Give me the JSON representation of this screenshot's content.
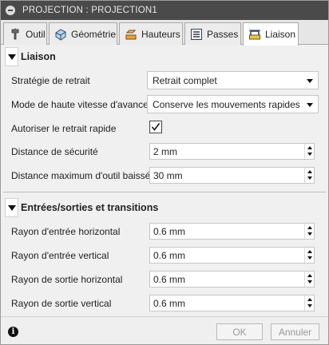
{
  "window": {
    "title": "PROJECTION : PROJECTION1"
  },
  "tabs": [
    {
      "label": "Outil",
      "icon": "tool-icon",
      "active": false
    },
    {
      "label": "Géométrie",
      "icon": "geometry-icon",
      "active": false
    },
    {
      "label": "Hauteurs",
      "icon": "heights-icon",
      "active": false
    },
    {
      "label": "Passes",
      "icon": "passes-icon",
      "active": false
    },
    {
      "label": "Liaison",
      "icon": "linking-icon",
      "active": true
    }
  ],
  "sections": {
    "liaison": {
      "title": "Liaison",
      "strategie": {
        "label": "Stratégie de retrait",
        "value": "Retrait complet"
      },
      "mode": {
        "label": "Mode de haute vitesse d'avance",
        "value": "Conserve les mouvements rapides"
      },
      "autoriser": {
        "label": "Autoriser le retrait rapide",
        "checked": true,
        "mark": "✓"
      },
      "distance_securite": {
        "label": "Distance de sécurité",
        "value": "2 mm"
      },
      "distance_max": {
        "label": "Distance maximum d'outil baissé",
        "value": "30 mm"
      }
    },
    "entrees": {
      "title": "Entrées/sorties et transitions",
      "rayon_entree_h": {
        "label": "Rayon d'entrée horizontal",
        "value": "0.6 mm"
      },
      "rayon_entree_v": {
        "label": "Rayon d'entrée vertical",
        "value": "0.6 mm"
      },
      "rayon_sortie_h": {
        "label": "Rayon de sortie horizontal",
        "value": "0.6 mm"
      },
      "rayon_sortie_v": {
        "label": "Rayon de sortie vertical",
        "value": "0.6 mm"
      }
    }
  },
  "footer": {
    "info": "i",
    "ok": "OK",
    "cancel": "Annuler"
  },
  "colors": {
    "titlebar": "#4a4a4a",
    "panel": "#f0f0f0",
    "disabled_text": "#9a9a9a"
  }
}
